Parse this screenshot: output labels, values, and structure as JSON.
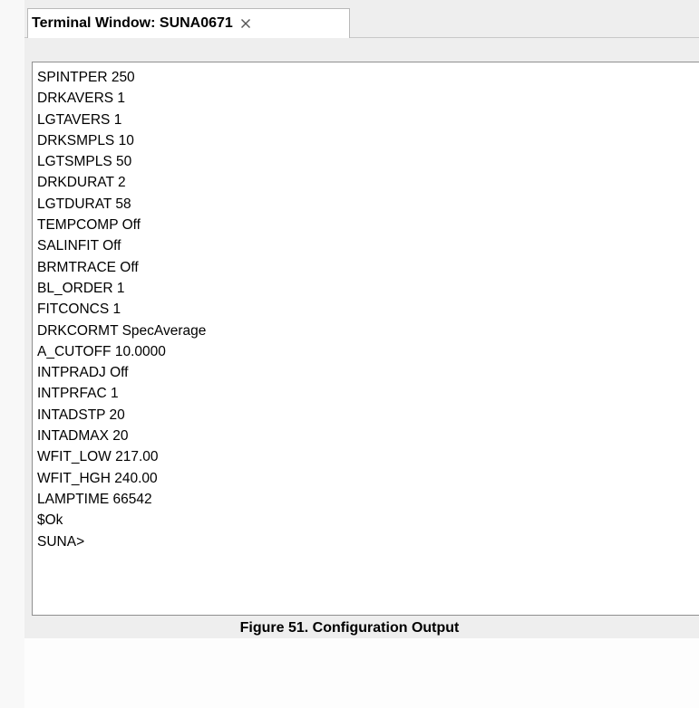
{
  "tab": {
    "title": "Terminal Window: SUNA0671",
    "close_glyph": "×"
  },
  "terminal": {
    "lines": [
      "SPINTPER 250",
      "DRKAVERS 1",
      "LGTAVERS 1",
      "DRKSMPLS 10",
      "LGTSMPLS 50",
      "DRKDURAT 2",
      "LGTDURAT 58",
      "TEMPCOMP Off",
      "SALINFIT Off",
      "BRMTRACE Off",
      "BL_ORDER 1",
      "FITCONCS 1",
      "DRKCORMT SpecAverage",
      "A_CUTOFF 10.0000",
      "INTPRADJ Off",
      "INTPRFAC 1",
      "INTADSTP 20",
      "INTADMAX 20",
      "WFIT_LOW 217.00",
      "WFIT_HGH 240.00",
      "LAMPTIME 66542",
      "$Ok",
      "SUNA>"
    ]
  },
  "caption": "Figure 51. Configuration Output",
  "colors": {
    "panel_background": "#eeeeee",
    "terminal_background": "#ffffff",
    "terminal_border": "#8f8f8f",
    "text": "#000000"
  },
  "icons": {
    "tab_close": "close-icon"
  }
}
